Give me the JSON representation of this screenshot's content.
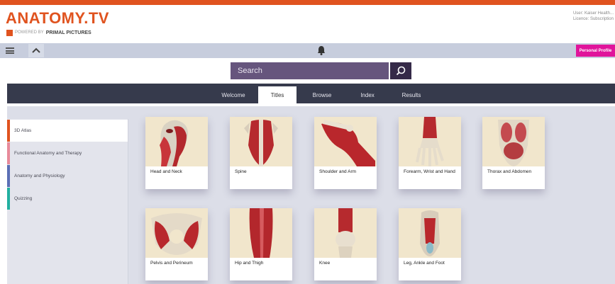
{
  "header": {
    "logo": "ANATOMY.TV",
    "powered_prefix": "POWERED BY",
    "powered_brand": "PRIMAL PICTURES",
    "user_line1": "User: Kaiser Health...",
    "user_line2": "Licence: Subscription"
  },
  "toolbar": {
    "personal_label": "Personal Profile"
  },
  "search": {
    "placeholder": "Search"
  },
  "nav": {
    "tabs": [
      {
        "label": "Welcome"
      },
      {
        "label": "Titles"
      },
      {
        "label": "Browse"
      },
      {
        "label": "Index"
      },
      {
        "label": "Results"
      }
    ],
    "active": "Titles"
  },
  "sidebar": {
    "items": [
      {
        "label": "3D Atlas",
        "color": "#e0531f"
      },
      {
        "label": "Functional Anatomy and Therapy",
        "color": "#e88a9a"
      },
      {
        "label": "Anatomy and Physiology",
        "color": "#5b6fb5"
      },
      {
        "label": "Quizzing",
        "color": "#22b0a0"
      }
    ]
  },
  "titles": [
    {
      "label": "Head and Neck"
    },
    {
      "label": "Spine"
    },
    {
      "label": "Shoulder and Arm"
    },
    {
      "label": "Forearm, Wrist and Hand"
    },
    {
      "label": "Thorax and Abdomen"
    },
    {
      "label": "Pelvis and Perineum"
    },
    {
      "label": "Hip and Thigh"
    },
    {
      "label": "Knee"
    },
    {
      "label": "Leg, Ankle and Foot"
    }
  ],
  "colors": {
    "brand": "#e0531f",
    "nav_bg": "#363a4c",
    "search_bg": "#66557d",
    "accent_pink": "#e0149b"
  }
}
